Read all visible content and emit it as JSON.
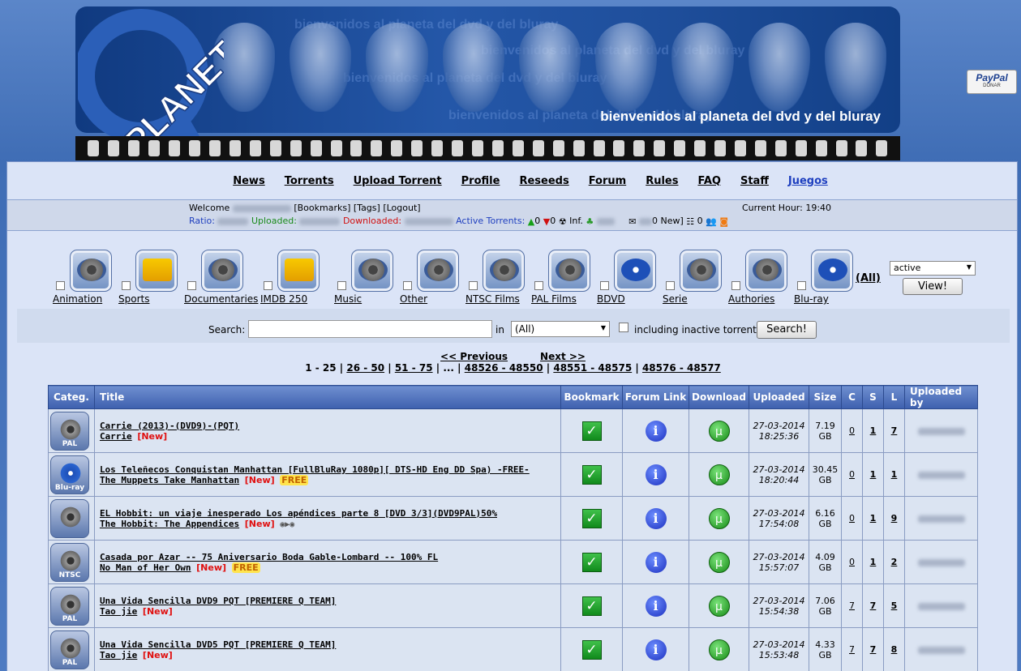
{
  "banner": {
    "tagline": "bienvenidos al planeta del dvd y del bluray",
    "bg_text": "bienvenidos al planeta del dvd y del bluray",
    "logo_text": "PLANET"
  },
  "paypal": {
    "brand": "PayPal",
    "label": "DONAR"
  },
  "nav": [
    "News",
    "Torrents",
    "Upload Torrent",
    "Profile",
    "Reseeds",
    "Forum",
    "Rules",
    "FAQ",
    "Staff",
    "Juegos"
  ],
  "info": {
    "welcome": "Welcome",
    "bookmarks": "[Bookmarks]",
    "tags": "[Tags]",
    "logout": "[Logout]",
    "current_hour": "Current Hour: 19:40",
    "ratio_label": "Ratio:",
    "uploaded_label": "Uploaded:",
    "downloaded_label": "Downloaded:",
    "active_label": "Active Torrents:",
    "seeding": "0",
    "leeching": "0",
    "inf_label": "Inf.",
    "messages": "0 New]",
    "other_count": "0"
  },
  "categories": [
    "Animation",
    "Sports",
    "Documentaries",
    "IMDB 250",
    "Music",
    "Other",
    "NTSC Films",
    "PAL Films",
    "BDVD",
    "Serie",
    "Authories",
    "Blu-ray"
  ],
  "filters": {
    "all": "(All)",
    "status": "active",
    "view": "View!"
  },
  "search": {
    "label": "Search:",
    "in": "in",
    "category": "(All)",
    "inactive": "including inactive torrents",
    "button": "Search!"
  },
  "pager": {
    "prev": "<< Previous",
    "next": "Next >>",
    "current": "1 - 25",
    "links": [
      "26 - 50",
      "51 - 75",
      "48526 - 48550",
      "48551 - 48575",
      "48576 - 48577"
    ],
    "ellipsis": "..."
  },
  "table": {
    "headers": [
      "Categ.",
      "Title",
      "Bookmark",
      "Forum Link",
      "Download",
      "Uploaded",
      "Size",
      "C",
      "S",
      "L",
      "Uploaded by"
    ],
    "new_label": "[New]",
    "free_label": "FREE",
    "rows": [
      {
        "cat": "PAL",
        "title": "Carrie (2013)-(DVD9)-(PQT)",
        "subtitle": "Carrie",
        "date": "27-03-2014",
        "time": "18:25:36",
        "size": "7.19",
        "unit": "GB",
        "c": "0",
        "s": "1",
        "l": "7",
        "free": false
      },
      {
        "cat": "Blu-ray",
        "title": "Los Teleñecos Conquistan Manhattan [FullBluRay 1080p][ DTS-HD Eng DD Spa) -FREE-",
        "subtitle": "The Muppets Take Manhattan",
        "date": "27-03-2014",
        "time": "18:20:44",
        "size": "30.45",
        "unit": "GB",
        "c": "0",
        "s": "1",
        "l": "1",
        "free": true
      },
      {
        "cat": "",
        "title": "EL Hobbit: un viaje inesperado Los apéndices parte 8 [DVD 3/3](DVD9PAL)50%",
        "subtitle": "The Hobbit: The Appendices",
        "date": "27-03-2014",
        "time": "17:54:08",
        "size": "6.16",
        "unit": "GB",
        "c": "0",
        "s": "1",
        "l": "9",
        "free": false
      },
      {
        "cat": "NTSC",
        "title": "Casada por Azar -- 75 Aniversario Boda Gable-Lombard -- 100% FL",
        "subtitle": "No Man of Her Own",
        "date": "27-03-2014",
        "time": "15:57:07",
        "size": "4.09",
        "unit": "GB",
        "c": "0",
        "s": "1",
        "l": "2",
        "free": true
      },
      {
        "cat": "PAL",
        "title": "Una Vida Sencilla DVD9 PQT [PREMIERE Q TEAM]",
        "subtitle": "Tao jie",
        "date": "27-03-2014",
        "time": "15:54:38",
        "size": "7.06",
        "unit": "GB",
        "c": "7",
        "s": "7",
        "l": "5",
        "free": false
      },
      {
        "cat": "PAL",
        "title": "Una Vida Sencilla DVD5 PQT [PREMIERE Q TEAM]",
        "subtitle": "Tao jie",
        "date": "27-03-2014",
        "time": "15:53:48",
        "size": "4.33",
        "unit": "GB",
        "c": "7",
        "s": "7",
        "l": "8",
        "free": false
      }
    ]
  }
}
